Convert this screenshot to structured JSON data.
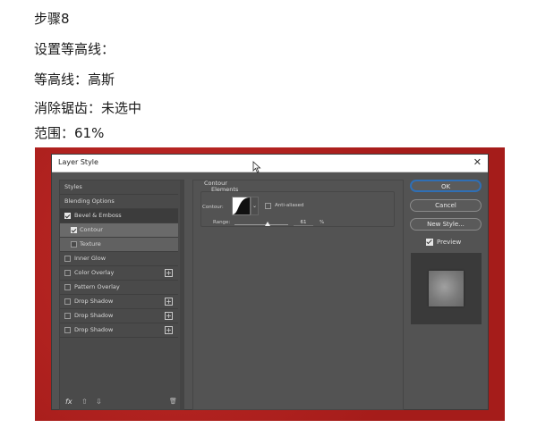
{
  "captions": [
    "步骤8",
    "设置等高线：",
    "等高线：高斯",
    "消除锯齿：未选中",
    "范围：61%"
  ],
  "dialog": {
    "title": "Layer Style",
    "close": "✕"
  },
  "left_panel": {
    "items": [
      {
        "label": "Styles"
      },
      {
        "label": "Blending Options"
      },
      {
        "label": "Bevel & Emboss",
        "checked": true
      },
      {
        "label": "Contour",
        "checked": true
      },
      {
        "label": "Texture",
        "checked": false
      },
      {
        "label": "Inner Glow",
        "checked": false
      },
      {
        "label": "Color Overlay",
        "checked": false,
        "plus": "+"
      },
      {
        "label": "Pattern Overlay",
        "checked": false
      },
      {
        "label": "Drop Shadow",
        "checked": false,
        "plus": "+"
      },
      {
        "label": "Drop Shadow",
        "checked": false,
        "plus": "+"
      },
      {
        "label": "Drop Shadow",
        "checked": false,
        "plus": "+"
      }
    ],
    "bottom": {
      "fx": "fx",
      "up": "⇧",
      "down": "⇩",
      "trash": "🗑"
    }
  },
  "contour_panel": {
    "group_title": "Contour",
    "subgroup_title": "Elements",
    "contour_label": "Contour:",
    "anti_aliased_label": "Anti-aliased",
    "anti_aliased": false,
    "range_label": "Range:",
    "range_value": "61",
    "range_unit": "%",
    "range_fraction": 0.61,
    "dropdown_arrow": "⌄"
  },
  "right_panel": {
    "ok_label": "OK",
    "cancel_label": "Cancel",
    "new_style_label": "New Style...",
    "preview_label": "Preview",
    "preview_checked": true
  },
  "colors": {
    "background_red": "#b3211f",
    "dialog_bg": "#535353",
    "ok_border": "#2f6fb5"
  }
}
